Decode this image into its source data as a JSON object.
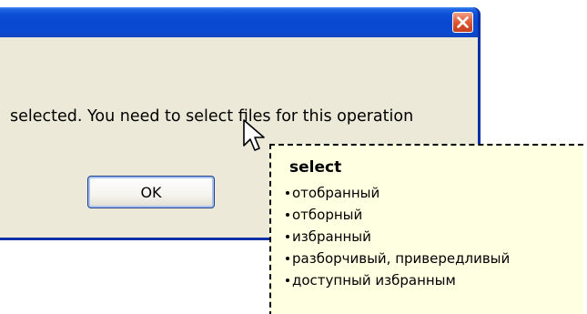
{
  "dialog": {
    "message": "selected. You need to select files for this operation",
    "ok_label": "OK",
    "close_icon": "close-icon",
    "colors": {
      "titlebar": "#0a4fd6",
      "client": "#ece9d8",
      "close_button": "#d24a26"
    }
  },
  "translation_popup": {
    "word": "select",
    "meanings": [
      "отобранный",
      "отборный",
      "избранный",
      "разборчивый, привередливый",
      "доступный избранным"
    ],
    "colors": {
      "background": "#ffffe1"
    }
  },
  "cursor": {
    "icon": "pointer-cursor-icon"
  }
}
